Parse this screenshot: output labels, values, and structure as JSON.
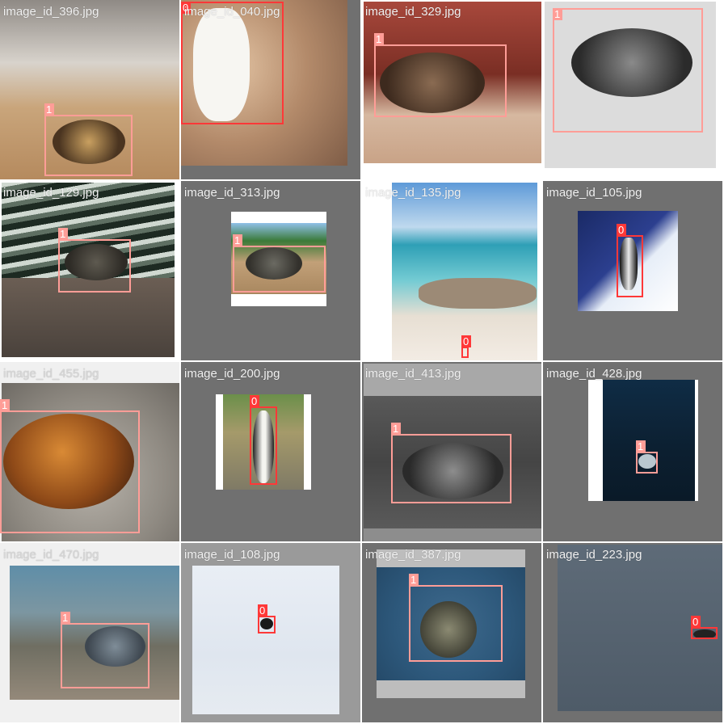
{
  "mosaic": {
    "box_colors": {
      "class_0": "#ff3838",
      "class_1": "#ff9d97"
    },
    "tiles": [
      {
        "filename": "image_id_396.jpg",
        "labels": [
          {
            "class": "1"
          }
        ]
      },
      {
        "filename": "image_id_040.jpg",
        "labels": [
          {
            "class": "0"
          }
        ]
      },
      {
        "filename": "image_id_329.jpg",
        "labels": [
          {
            "class": "1"
          }
        ]
      },
      {
        "filename": "",
        "labels": [
          {
            "class": "1"
          }
        ]
      },
      {
        "filename": "image_id_129.jpg",
        "labels": [
          {
            "class": "1"
          }
        ]
      },
      {
        "filename": "image_id_313.jpg",
        "labels": [
          {
            "class": "1"
          }
        ]
      },
      {
        "filename": "image_id_135.jpg",
        "labels": [
          {
            "class": "0"
          }
        ]
      },
      {
        "filename": "image_id_105.jpg",
        "labels": [
          {
            "class": "0"
          }
        ]
      },
      {
        "filename": "image_id_455.jpg",
        "labels": [
          {
            "class": "1"
          }
        ]
      },
      {
        "filename": "image_id_200.jpg",
        "labels": [
          {
            "class": "0"
          }
        ]
      },
      {
        "filename": "image_id_413.jpg",
        "labels": [
          {
            "class": "1"
          }
        ]
      },
      {
        "filename": "image_id_428.jpg",
        "labels": [
          {
            "class": "1"
          }
        ]
      },
      {
        "filename": "image_id_470.jpg",
        "labels": [
          {
            "class": "1"
          }
        ]
      },
      {
        "filename": "image_id_108.jpg",
        "labels": [
          {
            "class": "0"
          }
        ]
      },
      {
        "filename": "image_id_387.jpg",
        "labels": [
          {
            "class": "1"
          }
        ]
      },
      {
        "filename": "image_id_223.jpg",
        "labels": [
          {
            "class": "0"
          }
        ]
      }
    ]
  }
}
